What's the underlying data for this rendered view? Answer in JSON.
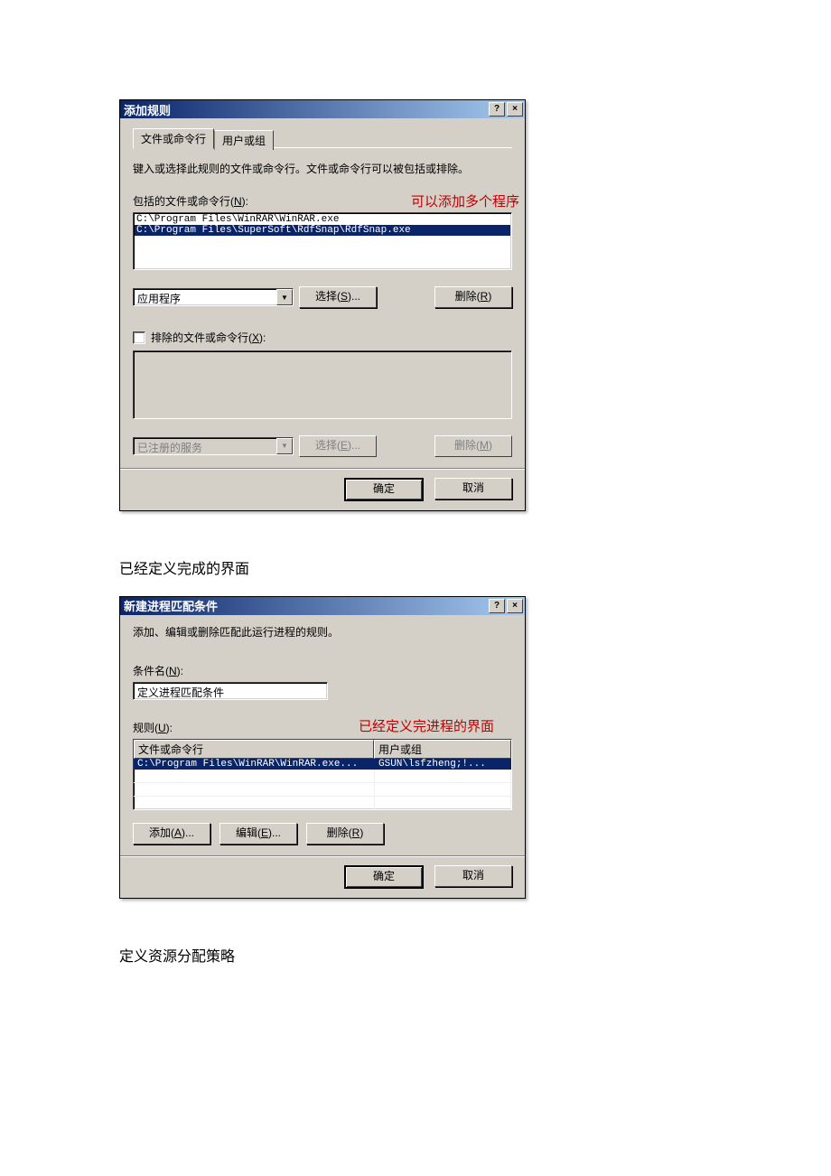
{
  "dialog1": {
    "title": "添加规则",
    "help_btn": "?",
    "close_btn": "×",
    "tabs": {
      "file_cmd": "文件或命令行",
      "user_group": "用户或组"
    },
    "instruction": "键入或选择此规则的文件或命令行。文件或命令行可以被包括或排除。",
    "include_label_pre": "包括的文件或命令行(",
    "include_label_key": "N",
    "include_label_post": "):",
    "annotation1": "可以添加多个程序",
    "include_list": [
      "C:\\Program Files\\WinRAR\\WinRAR.exe",
      "C:\\Program Files\\SuperSoft\\RdfSnap\\RdfSnap.exe"
    ],
    "include_selected_index": 1,
    "dropdown1_value": "应用程序",
    "select_btn_pre": "选择(",
    "select_btn_key": "S",
    "select_btn_post": ")...",
    "remove_btn_pre": "删除(",
    "remove_btn_key": "R",
    "remove_btn_post": ")",
    "exclude_label_pre": "排除的文件或命令行(",
    "exclude_label_key": "X",
    "exclude_label_post": "):",
    "dropdown2_value": "已注册的服务",
    "select2_btn_pre": "选择(",
    "select2_btn_key": "E",
    "select2_btn_post": ")...",
    "remove2_btn_pre": "删除(",
    "remove2_btn_key": "M",
    "remove2_btn_post": ")",
    "ok_btn": "确定",
    "cancel_btn": "取消"
  },
  "caption1": "已经定义完成的界面",
  "dialog2": {
    "title": "新建进程匹配条件",
    "help_btn": "?",
    "close_btn": "×",
    "instruction": "添加、编辑或删除匹配此运行进程的规则。",
    "name_label_pre": "条件名(",
    "name_label_key": "N",
    "name_label_post": "):",
    "name_value": "定义进程匹配条件",
    "rules_label_pre": "规则(",
    "rules_label_key": "U",
    "rules_label_post": "):",
    "annotation2": "已经定义完进程的界面",
    "col1": "文件或命令行",
    "col2": "用户或组",
    "table_rows": [
      {
        "file": "C:\\Program Files\\WinRAR\\WinRAR.exe...",
        "user": "GSUN\\lsfzheng;!..."
      }
    ],
    "add_btn_pre": "添加(",
    "add_btn_key": "A",
    "add_btn_post": ")...",
    "edit_btn_pre": "编辑(",
    "edit_btn_key": "E",
    "edit_btn_post": ")...",
    "remove_btn_pre": "删除(",
    "remove_btn_key": "R",
    "remove_btn_post": ")",
    "ok_btn": "确定",
    "cancel_btn": "取消"
  },
  "caption2": "定义资源分配策略"
}
